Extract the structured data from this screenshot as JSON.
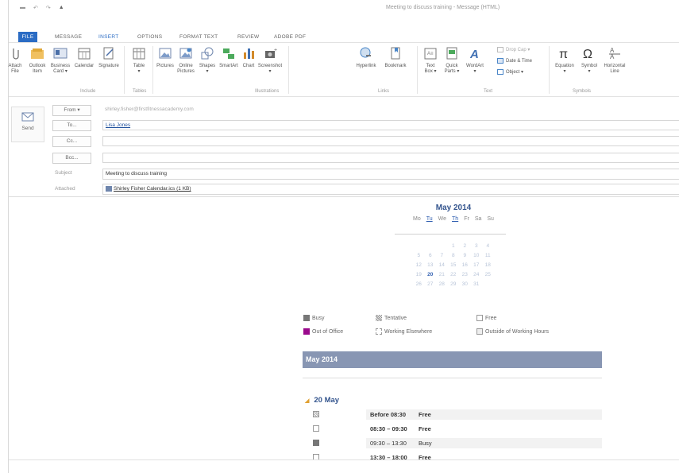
{
  "window": {
    "title": "Meeting to discuss training - Message (HTML)"
  },
  "tabs": [
    "FILE",
    "MESSAGE",
    "INSERT",
    "OPTIONS",
    "FORMAT TEXT",
    "REVIEW",
    "ADOBE PDF"
  ],
  "ribbon": {
    "items": [
      {
        "label": "Attach\nFile",
        "icon": "paperclip-icon"
      },
      {
        "label": "Outlook\nItem",
        "icon": "envelope-icon"
      },
      {
        "label": "Business\nCard ▾",
        "icon": "business-card-icon"
      },
      {
        "label": "Calendar",
        "icon": "calendar-icon"
      },
      {
        "label": "Signature",
        "icon": "signature-icon"
      },
      {
        "label": "Table\n▾",
        "icon": "table-icon"
      },
      {
        "label": "Pictures",
        "icon": "pictures-icon"
      },
      {
        "label": "Online\nPictures",
        "icon": "online-pictures-icon"
      },
      {
        "label": "Shapes\n▾",
        "icon": "shapes-icon"
      },
      {
        "label": "SmartArt",
        "icon": "smartart-icon"
      },
      {
        "label": "Chart",
        "icon": "chart-icon"
      },
      {
        "label": "Screenshot\n▾",
        "icon": "screenshot-icon"
      },
      {
        "label": "Hyperlink",
        "icon": "hyperlink-icon"
      },
      {
        "label": "Bookmark",
        "icon": "bookmark-icon"
      },
      {
        "label": "Text\nBox ▾",
        "icon": "textbox-icon"
      },
      {
        "label": "Quick\nParts ▾",
        "icon": "quick-parts-icon"
      },
      {
        "label": "WordArt\n▾",
        "icon": "wordart-icon"
      },
      {
        "label": "Equation\n▾",
        "icon": "equation-icon"
      },
      {
        "label": "Symbol\n▾",
        "icon": "omega-icon"
      },
      {
        "label": "Horizontal\nLine",
        "icon": "horizontal-line-icon"
      }
    ],
    "small": {
      "drop_cap": "Drop Cap ▾",
      "date_time": "Date & Time",
      "object": "Object ▾"
    },
    "groups": [
      "Include",
      "Tables",
      "Illustrations",
      "Links",
      "Text",
      "Symbols"
    ]
  },
  "send": {
    "label": "Send"
  },
  "header": {
    "from_label": "From ▾",
    "from_value": "shirley.fisher@firstfitnessacademy.com",
    "to_label": "To...",
    "to_value": "Lisa Jones",
    "cc_label": "Cc...",
    "bcc_label": "Bcc...",
    "subject_label": "Subject",
    "subject_value": "Meeting to discuss training",
    "attached_label": "Attached",
    "attached_value": "Shirley Fisher Calendar.ics (1 KB)"
  },
  "calendar": {
    "title": "May 2014",
    "days": [
      "Mo",
      "Tu",
      "We",
      "Th",
      "Fr",
      "Sa",
      "Su"
    ],
    "weeks": [
      [
        "",
        "",
        "",
        "1",
        "2",
        "3",
        "4"
      ],
      [
        "5",
        "6",
        "7",
        "8",
        "9",
        "10",
        "11"
      ],
      [
        "12",
        "13",
        "14",
        "15",
        "16",
        "17",
        "18"
      ],
      [
        "19",
        "20",
        "21",
        "22",
        "23",
        "24",
        "25"
      ],
      [
        "26",
        "27",
        "28",
        "29",
        "30",
        "31",
        ""
      ]
    ],
    "highlight": "20"
  },
  "legend": {
    "busy": "Busy",
    "tentative": "Tentative",
    "free": "Free",
    "oof": "Out of Office",
    "elsewhere": "Working Elsewhere",
    "outside": "Outside of Working Hours"
  },
  "colors": {
    "accent": "#2b6cc4",
    "oof": "#9a0a8c",
    "busy": "#777777",
    "month_bar": "#8896b3"
  },
  "month_bar": "May 2014",
  "day": {
    "label": "20 May",
    "rows": [
      {
        "time": "Before 08:30",
        "status": "Free",
        "box": "tentative"
      },
      {
        "time": "08:30 – 09:30",
        "status": "Free",
        "box": "free"
      },
      {
        "time": "09:30 – 13:30",
        "status": "Busy",
        "box": "busy"
      },
      {
        "time": "13:30 – 18:00",
        "status": "Free",
        "box": "free"
      }
    ]
  }
}
